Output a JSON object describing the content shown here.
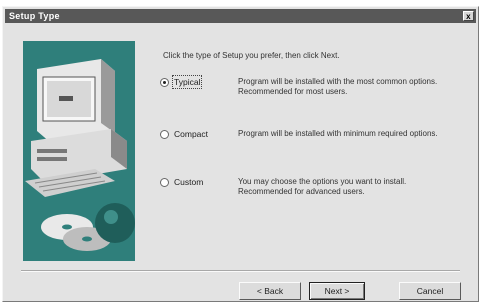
{
  "window": {
    "title": "Setup Type",
    "close_glyph": "x"
  },
  "instruction": "Click the type of Setup you prefer, then click Next.",
  "options": [
    {
      "label": "Typical",
      "description": "Program will be installed with the most common options.  Recommended for most users.",
      "checked": true
    },
    {
      "label": "Compact",
      "description": "Program will be installed with minimum required options.",
      "checked": false
    },
    {
      "label": "Custom",
      "description": "You may choose the options you want to install. Recommended for advanced users.",
      "checked": false
    }
  ],
  "buttons": {
    "back": "< Back",
    "next": "Next >",
    "cancel": "Cancel"
  },
  "art": {
    "background_color": "#2f7f7b",
    "illustration": "computer-with-cd-icon"
  }
}
